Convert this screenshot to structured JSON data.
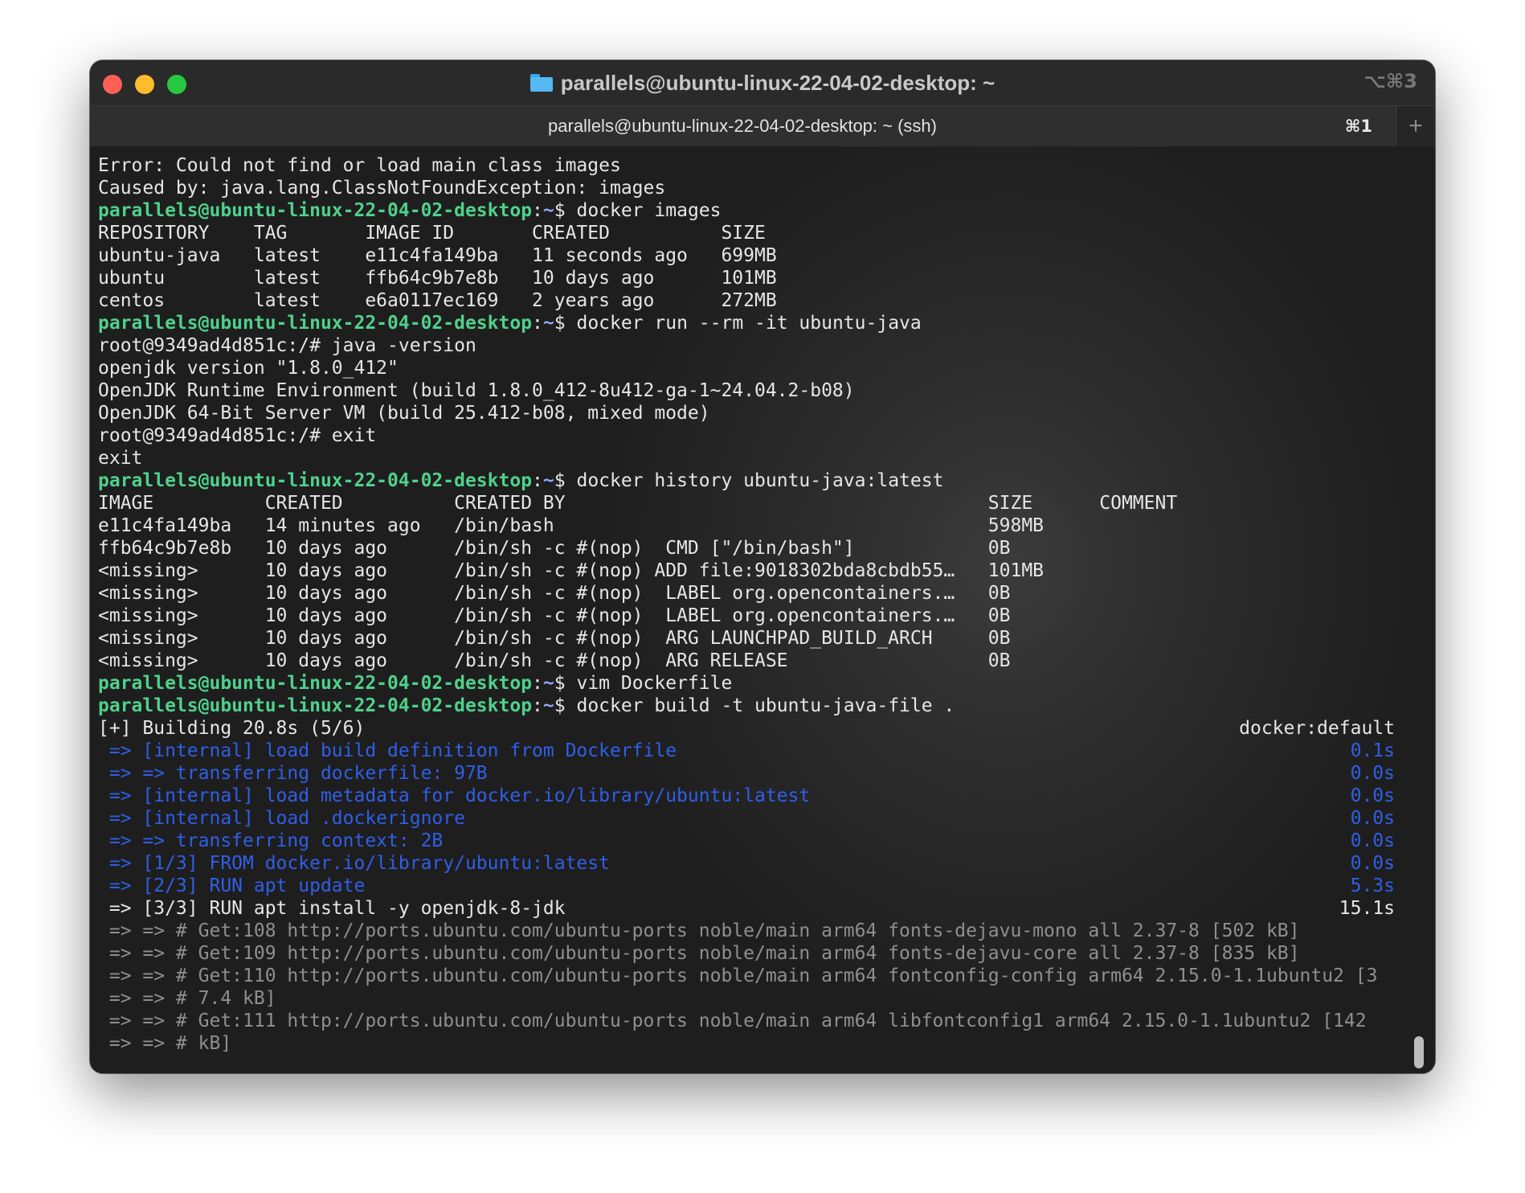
{
  "window": {
    "title": "parallels@ubuntu-linux-22-04-02-desktop: ~",
    "shortcut": "⌥⌘3",
    "folder_icon": "folder-icon"
  },
  "tabs": [
    {
      "label": "parallels@ubuntu-linux-22-04-02-desktop: ~ (ssh)",
      "shortcut": "⌘1"
    }
  ],
  "new_tab_label": "+",
  "terminal": {
    "lines": [
      {
        "type": "plain",
        "text": "Error: Could not find or load main class images"
      },
      {
        "type": "plain",
        "text": "Caused by: java.lang.ClassNotFoundException: images"
      },
      {
        "type": "prompt",
        "user": "parallels@ubuntu-linux-22-04-02-desktop",
        "path": "~",
        "cmd": "docker images"
      },
      {
        "type": "plain",
        "text": "REPOSITORY    TAG       IMAGE ID       CREATED          SIZE"
      },
      {
        "type": "plain",
        "text": "ubuntu-java   latest    e11c4fa149ba   11 seconds ago   699MB"
      },
      {
        "type": "plain",
        "text": "ubuntu        latest    ffb64c9b7e8b   10 days ago      101MB"
      },
      {
        "type": "plain",
        "text": "centos        latest    e6a0117ec169   2 years ago      272MB"
      },
      {
        "type": "prompt",
        "user": "parallels@ubuntu-linux-22-04-02-desktop",
        "path": "~",
        "cmd": "docker run --rm -it ubuntu-java"
      },
      {
        "type": "plain",
        "text": "root@9349ad4d851c:/# java -version"
      },
      {
        "type": "plain",
        "text": "openjdk version \"1.8.0_412\""
      },
      {
        "type": "plain",
        "text": "OpenJDK Runtime Environment (build 1.8.0_412-8u412-ga-1~24.04.2-b08)"
      },
      {
        "type": "plain",
        "text": "OpenJDK 64-Bit Server VM (build 25.412-b08, mixed mode)"
      },
      {
        "type": "plain",
        "text": "root@9349ad4d851c:/# exit"
      },
      {
        "type": "plain",
        "text": "exit"
      },
      {
        "type": "prompt",
        "user": "parallels@ubuntu-linux-22-04-02-desktop",
        "path": "~",
        "cmd": "docker history ubuntu-java:latest"
      },
      {
        "type": "plain",
        "text": "IMAGE          CREATED          CREATED BY                                      SIZE      COMMENT"
      },
      {
        "type": "plain",
        "text": "e11c4fa149ba   14 minutes ago   /bin/bash                                       598MB"
      },
      {
        "type": "plain",
        "text": "ffb64c9b7e8b   10 days ago      /bin/sh -c #(nop)  CMD [\"/bin/bash\"]            0B"
      },
      {
        "type": "plain",
        "text": "<missing>      10 days ago      /bin/sh -c #(nop) ADD file:9018302bda8cbdb55…   101MB"
      },
      {
        "type": "plain",
        "text": "<missing>      10 days ago      /bin/sh -c #(nop)  LABEL org.opencontainers.…   0B"
      },
      {
        "type": "plain",
        "text": "<missing>      10 days ago      /bin/sh -c #(nop)  LABEL org.opencontainers.…   0B"
      },
      {
        "type": "plain",
        "text": "<missing>      10 days ago      /bin/sh -c #(nop)  ARG LAUNCHPAD_BUILD_ARCH     0B"
      },
      {
        "type": "plain",
        "text": "<missing>      10 days ago      /bin/sh -c #(nop)  ARG RELEASE                  0B"
      },
      {
        "type": "prompt",
        "user": "parallels@ubuntu-linux-22-04-02-desktop",
        "path": "~",
        "cmd": "vim Dockerfile"
      },
      {
        "type": "prompt",
        "user": "parallels@ubuntu-linux-22-04-02-desktop",
        "path": "~",
        "cmd": "docker build -t ubuntu-java-file ."
      },
      {
        "type": "status",
        "text": "[+] Building 20.8s (5/6)",
        "right": "docker:default",
        "color": "plain"
      },
      {
        "type": "status",
        "text": " => [internal] load build definition from Dockerfile",
        "right": "0.1s",
        "color": "blue"
      },
      {
        "type": "status",
        "text": " => => transferring dockerfile: 97B",
        "right": "0.0s",
        "color": "blue"
      },
      {
        "type": "status",
        "text": " => [internal] load metadata for docker.io/library/ubuntu:latest",
        "right": "0.0s",
        "color": "blue"
      },
      {
        "type": "status",
        "text": " => [internal] load .dockerignore",
        "right": "0.0s",
        "color": "blue"
      },
      {
        "type": "status",
        "text": " => => transferring context: 2B",
        "right": "0.0s",
        "color": "blue"
      },
      {
        "type": "status",
        "text": " => [1/3] FROM docker.io/library/ubuntu:latest",
        "right": "0.0s",
        "color": "blue"
      },
      {
        "type": "status",
        "text": " => [2/3] RUN apt update",
        "right": "5.3s",
        "color": "blue"
      },
      {
        "type": "status",
        "text": " => [3/3] RUN apt install -y openjdk-8-jdk",
        "right": "15.1s",
        "color": "plain"
      },
      {
        "type": "grey",
        "text": " => => # Get:108 http://ports.ubuntu.com/ubuntu-ports noble/main arm64 fonts-dejavu-mono all 2.37-8 [502 kB]"
      },
      {
        "type": "grey",
        "text": " => => # Get:109 http://ports.ubuntu.com/ubuntu-ports noble/main arm64 fonts-dejavu-core all 2.37-8 [835 kB]"
      },
      {
        "type": "grey",
        "text": " => => # Get:110 http://ports.ubuntu.com/ubuntu-ports noble/main arm64 fontconfig-config arm64 2.15.0-1.1ubuntu2 [3"
      },
      {
        "type": "grey",
        "text": " => => # 7.4 kB]"
      },
      {
        "type": "grey",
        "text": " => => # Get:111 http://ports.ubuntu.com/ubuntu-ports noble/main arm64 libfontconfig1 arm64 2.15.0-1.1ubuntu2 [142"
      },
      {
        "type": "grey",
        "text": " => => # kB]"
      }
    ]
  }
}
